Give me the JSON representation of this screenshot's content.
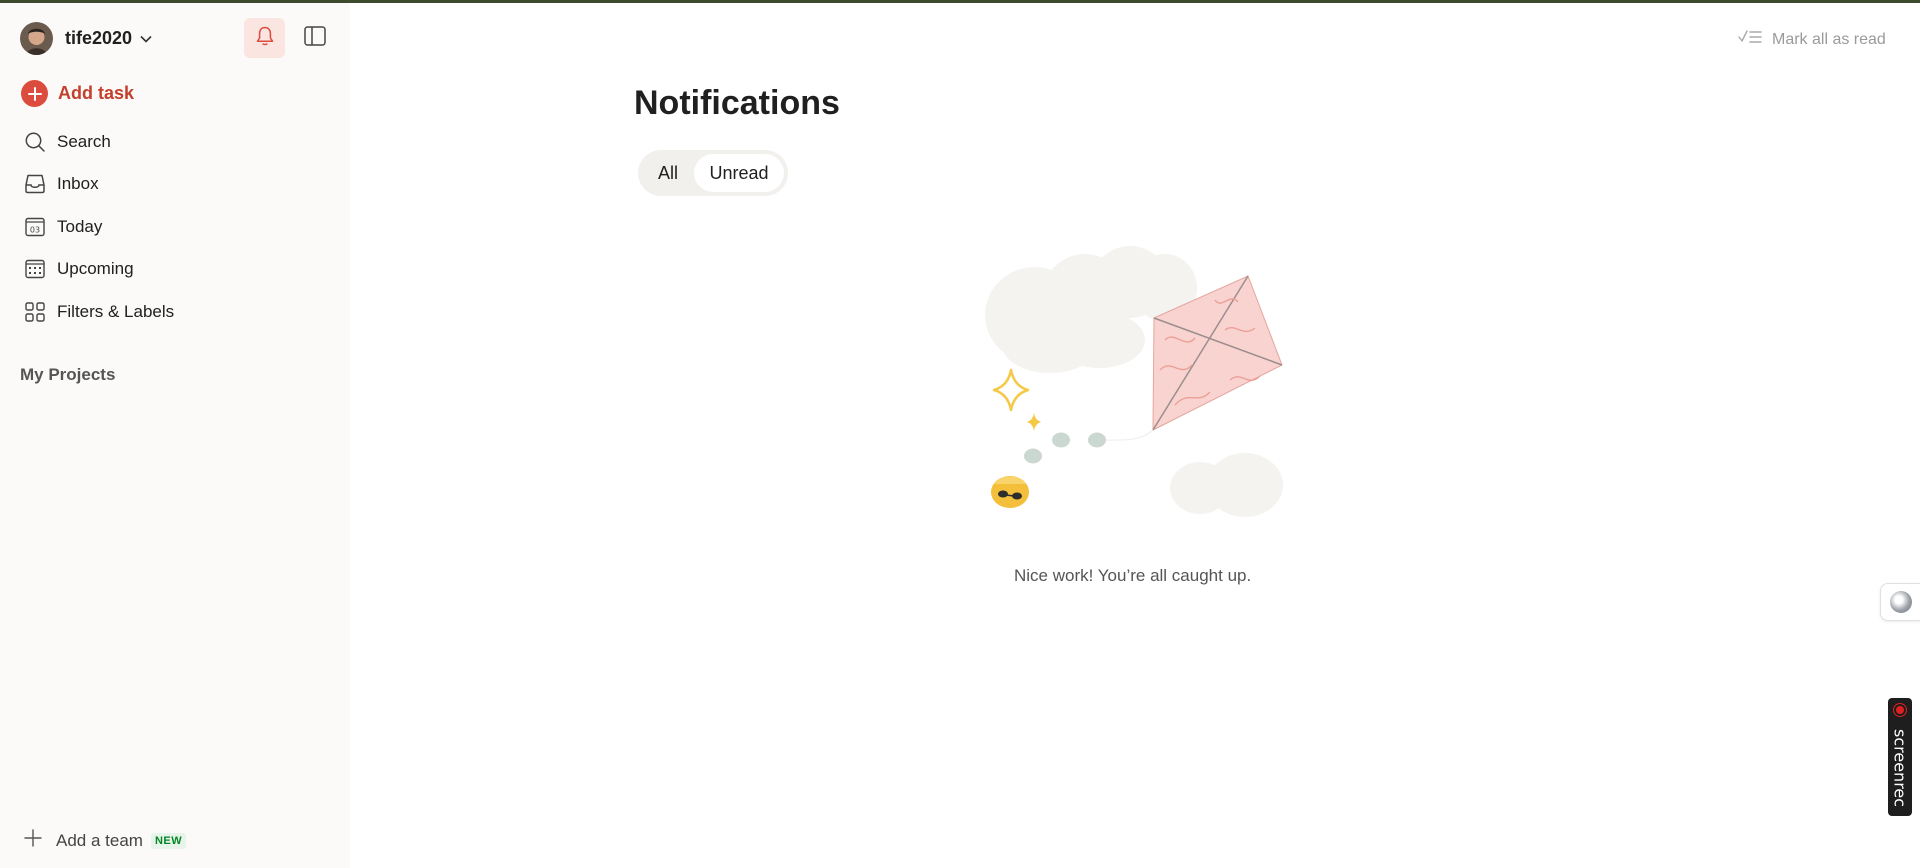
{
  "sidebar": {
    "account": {
      "username": "tife2020"
    },
    "add_task_label": "Add task",
    "nav": [
      {
        "label": "Search",
        "icon": "search-icon"
      },
      {
        "label": "Inbox",
        "icon": "inbox-icon"
      },
      {
        "label": "Today",
        "icon": "calendar-today-icon"
      },
      {
        "label": "Upcoming",
        "icon": "calendar-grid-icon"
      },
      {
        "label": "Filters & Labels",
        "icon": "filters-grid-icon"
      }
    ],
    "projects_label": "My Projects",
    "add_team_label": "Add a team",
    "add_team_badge": "NEW"
  },
  "main": {
    "mark_all_label": "Mark all as read",
    "title": "Notifications",
    "tabs": [
      {
        "label": "All",
        "selected": false
      },
      {
        "label": "Unread",
        "selected": true
      }
    ],
    "empty_message": "Nice work! You’re all caught up.",
    "illustration": "kite-clouds-illustration"
  },
  "overlay": {
    "recorder_label": "screenrec"
  },
  "colors": {
    "accent": "#dc4c3e",
    "accent_text": "#c3402c",
    "sidebar_bg": "#fcfaf8",
    "bell_active_bg": "#fbe5e1",
    "badge_green": "#058527"
  }
}
